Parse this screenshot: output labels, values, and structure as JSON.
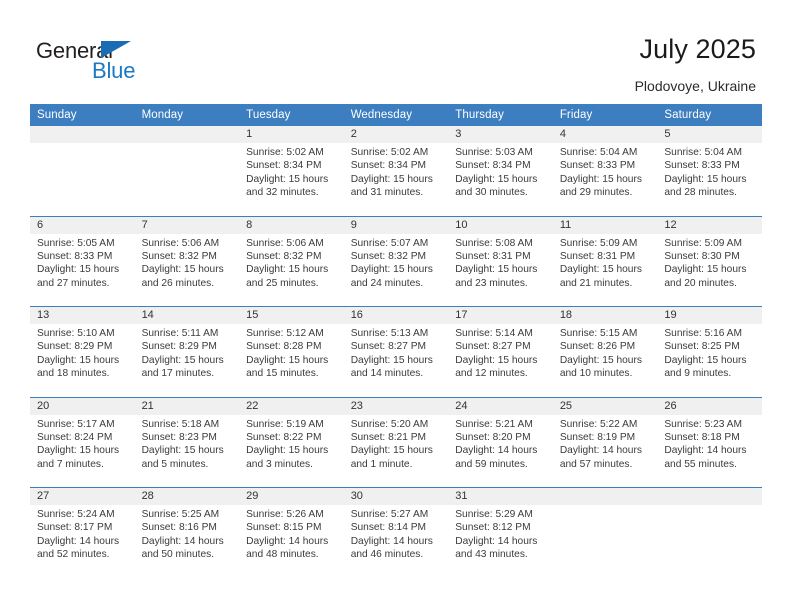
{
  "brand": {
    "name_top": "General",
    "name_bottom": "Blue",
    "accent_color": "#1a7ac4",
    "triangle_color": "#1a6cb5"
  },
  "header": {
    "title": "July 2025",
    "subtitle": "Plodovoye, Ukraine"
  },
  "calendar": {
    "header_bg": "#3c7ebf",
    "daynum_bg": "#f0f0f0",
    "weekdays": [
      "Sunday",
      "Monday",
      "Tuesday",
      "Wednesday",
      "Thursday",
      "Friday",
      "Saturday"
    ],
    "weeks": [
      [
        {
          "day": "",
          "sunrise": "",
          "sunset": "",
          "daylight_1": "",
          "daylight_2": ""
        },
        {
          "day": "",
          "sunrise": "",
          "sunset": "",
          "daylight_1": "",
          "daylight_2": ""
        },
        {
          "day": "1",
          "sunrise": "Sunrise: 5:02 AM",
          "sunset": "Sunset: 8:34 PM",
          "daylight_1": "Daylight: 15 hours",
          "daylight_2": "and 32 minutes."
        },
        {
          "day": "2",
          "sunrise": "Sunrise: 5:02 AM",
          "sunset": "Sunset: 8:34 PM",
          "daylight_1": "Daylight: 15 hours",
          "daylight_2": "and 31 minutes."
        },
        {
          "day": "3",
          "sunrise": "Sunrise: 5:03 AM",
          "sunset": "Sunset: 8:34 PM",
          "daylight_1": "Daylight: 15 hours",
          "daylight_2": "and 30 minutes."
        },
        {
          "day": "4",
          "sunrise": "Sunrise: 5:04 AM",
          "sunset": "Sunset: 8:33 PM",
          "daylight_1": "Daylight: 15 hours",
          "daylight_2": "and 29 minutes."
        },
        {
          "day": "5",
          "sunrise": "Sunrise: 5:04 AM",
          "sunset": "Sunset: 8:33 PM",
          "daylight_1": "Daylight: 15 hours",
          "daylight_2": "and 28 minutes."
        }
      ],
      [
        {
          "day": "6",
          "sunrise": "Sunrise: 5:05 AM",
          "sunset": "Sunset: 8:33 PM",
          "daylight_1": "Daylight: 15 hours",
          "daylight_2": "and 27 minutes."
        },
        {
          "day": "7",
          "sunrise": "Sunrise: 5:06 AM",
          "sunset": "Sunset: 8:32 PM",
          "daylight_1": "Daylight: 15 hours",
          "daylight_2": "and 26 minutes."
        },
        {
          "day": "8",
          "sunrise": "Sunrise: 5:06 AM",
          "sunset": "Sunset: 8:32 PM",
          "daylight_1": "Daylight: 15 hours",
          "daylight_2": "and 25 minutes."
        },
        {
          "day": "9",
          "sunrise": "Sunrise: 5:07 AM",
          "sunset": "Sunset: 8:32 PM",
          "daylight_1": "Daylight: 15 hours",
          "daylight_2": "and 24 minutes."
        },
        {
          "day": "10",
          "sunrise": "Sunrise: 5:08 AM",
          "sunset": "Sunset: 8:31 PM",
          "daylight_1": "Daylight: 15 hours",
          "daylight_2": "and 23 minutes."
        },
        {
          "day": "11",
          "sunrise": "Sunrise: 5:09 AM",
          "sunset": "Sunset: 8:31 PM",
          "daylight_1": "Daylight: 15 hours",
          "daylight_2": "and 21 minutes."
        },
        {
          "day": "12",
          "sunrise": "Sunrise: 5:09 AM",
          "sunset": "Sunset: 8:30 PM",
          "daylight_1": "Daylight: 15 hours",
          "daylight_2": "and 20 minutes."
        }
      ],
      [
        {
          "day": "13",
          "sunrise": "Sunrise: 5:10 AM",
          "sunset": "Sunset: 8:29 PM",
          "daylight_1": "Daylight: 15 hours",
          "daylight_2": "and 18 minutes."
        },
        {
          "day": "14",
          "sunrise": "Sunrise: 5:11 AM",
          "sunset": "Sunset: 8:29 PM",
          "daylight_1": "Daylight: 15 hours",
          "daylight_2": "and 17 minutes."
        },
        {
          "day": "15",
          "sunrise": "Sunrise: 5:12 AM",
          "sunset": "Sunset: 8:28 PM",
          "daylight_1": "Daylight: 15 hours",
          "daylight_2": "and 15 minutes."
        },
        {
          "day": "16",
          "sunrise": "Sunrise: 5:13 AM",
          "sunset": "Sunset: 8:27 PM",
          "daylight_1": "Daylight: 15 hours",
          "daylight_2": "and 14 minutes."
        },
        {
          "day": "17",
          "sunrise": "Sunrise: 5:14 AM",
          "sunset": "Sunset: 8:27 PM",
          "daylight_1": "Daylight: 15 hours",
          "daylight_2": "and 12 minutes."
        },
        {
          "day": "18",
          "sunrise": "Sunrise: 5:15 AM",
          "sunset": "Sunset: 8:26 PM",
          "daylight_1": "Daylight: 15 hours",
          "daylight_2": "and 10 minutes."
        },
        {
          "day": "19",
          "sunrise": "Sunrise: 5:16 AM",
          "sunset": "Sunset: 8:25 PM",
          "daylight_1": "Daylight: 15 hours",
          "daylight_2": "and 9 minutes."
        }
      ],
      [
        {
          "day": "20",
          "sunrise": "Sunrise: 5:17 AM",
          "sunset": "Sunset: 8:24 PM",
          "daylight_1": "Daylight: 15 hours",
          "daylight_2": "and 7 minutes."
        },
        {
          "day": "21",
          "sunrise": "Sunrise: 5:18 AM",
          "sunset": "Sunset: 8:23 PM",
          "daylight_1": "Daylight: 15 hours",
          "daylight_2": "and 5 minutes."
        },
        {
          "day": "22",
          "sunrise": "Sunrise: 5:19 AM",
          "sunset": "Sunset: 8:22 PM",
          "daylight_1": "Daylight: 15 hours",
          "daylight_2": "and 3 minutes."
        },
        {
          "day": "23",
          "sunrise": "Sunrise: 5:20 AM",
          "sunset": "Sunset: 8:21 PM",
          "daylight_1": "Daylight: 15 hours",
          "daylight_2": "and 1 minute."
        },
        {
          "day": "24",
          "sunrise": "Sunrise: 5:21 AM",
          "sunset": "Sunset: 8:20 PM",
          "daylight_1": "Daylight: 14 hours",
          "daylight_2": "and 59 minutes."
        },
        {
          "day": "25",
          "sunrise": "Sunrise: 5:22 AM",
          "sunset": "Sunset: 8:19 PM",
          "daylight_1": "Daylight: 14 hours",
          "daylight_2": "and 57 minutes."
        },
        {
          "day": "26",
          "sunrise": "Sunrise: 5:23 AM",
          "sunset": "Sunset: 8:18 PM",
          "daylight_1": "Daylight: 14 hours",
          "daylight_2": "and 55 minutes."
        }
      ],
      [
        {
          "day": "27",
          "sunrise": "Sunrise: 5:24 AM",
          "sunset": "Sunset: 8:17 PM",
          "daylight_1": "Daylight: 14 hours",
          "daylight_2": "and 52 minutes."
        },
        {
          "day": "28",
          "sunrise": "Sunrise: 5:25 AM",
          "sunset": "Sunset: 8:16 PM",
          "daylight_1": "Daylight: 14 hours",
          "daylight_2": "and 50 minutes."
        },
        {
          "day": "29",
          "sunrise": "Sunrise: 5:26 AM",
          "sunset": "Sunset: 8:15 PM",
          "daylight_1": "Daylight: 14 hours",
          "daylight_2": "and 48 minutes."
        },
        {
          "day": "30",
          "sunrise": "Sunrise: 5:27 AM",
          "sunset": "Sunset: 8:14 PM",
          "daylight_1": "Daylight: 14 hours",
          "daylight_2": "and 46 minutes."
        },
        {
          "day": "31",
          "sunrise": "Sunrise: 5:29 AM",
          "sunset": "Sunset: 8:12 PM",
          "daylight_1": "Daylight: 14 hours",
          "daylight_2": "and 43 minutes."
        },
        {
          "day": "",
          "sunrise": "",
          "sunset": "",
          "daylight_1": "",
          "daylight_2": ""
        },
        {
          "day": "",
          "sunrise": "",
          "sunset": "",
          "daylight_1": "",
          "daylight_2": ""
        }
      ]
    ]
  }
}
